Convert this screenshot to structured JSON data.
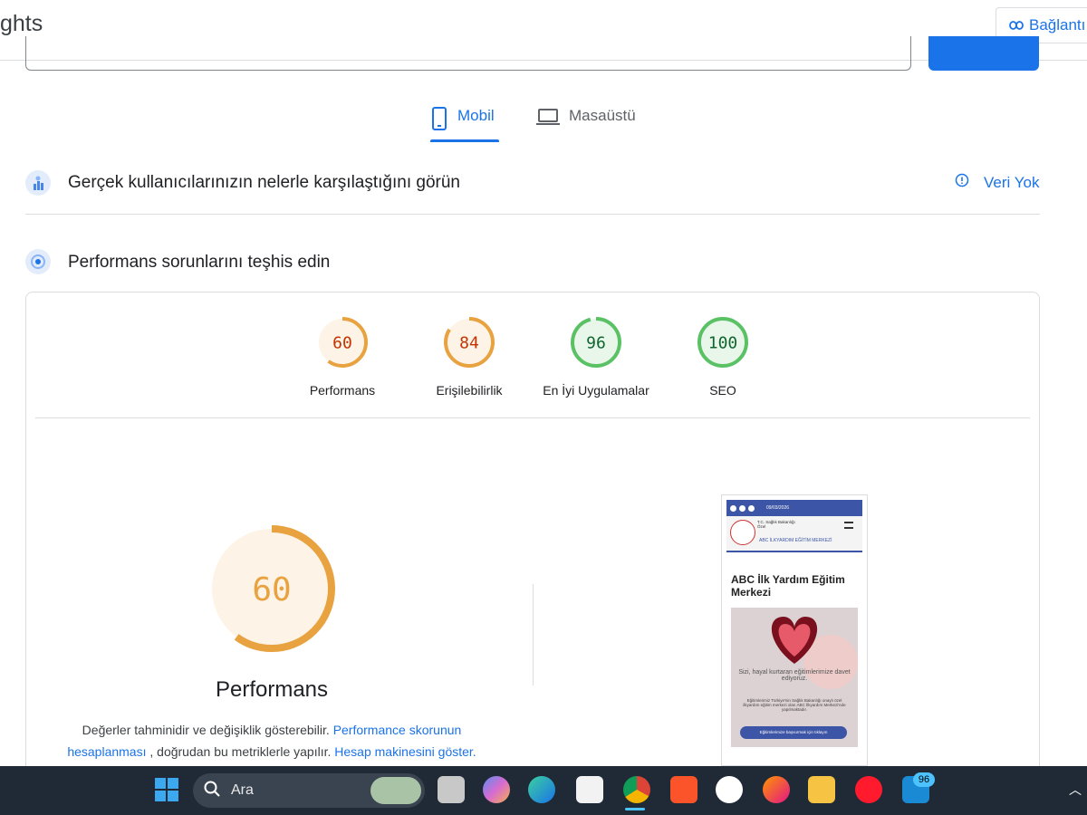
{
  "header": {
    "app_title": "ghts",
    "link_button_label": "Bağlantı"
  },
  "tabs": [
    {
      "label": "Mobil",
      "active": true
    },
    {
      "label": "Masaüstü",
      "active": false
    }
  ],
  "real_users": {
    "title": "Gerçek kullanıcılarınızın nelerle karşılaştığını görün",
    "status": "Veri Yok"
  },
  "diagnose": {
    "title": "Performans sorunlarını teşhis edin"
  },
  "scores": [
    {
      "value": "60",
      "label": "Performans",
      "color": "#e8a23f",
      "fraction": 0.6
    },
    {
      "value": "84",
      "label": "Erişilebilirlik",
      "color": "#e8a23f",
      "fraction": 0.84
    },
    {
      "value": "96",
      "label": "En İyi Uygulamalar",
      "color": "#5ac165",
      "fraction": 0.96
    },
    {
      "value": "100",
      "label": "SEO",
      "color": "#5ac165",
      "fraction": 1.0
    }
  ],
  "performance_detail": {
    "score": "60",
    "title": "Performans",
    "note_text_1": "Değerler tahminidir ve değişiklik gösterebilir.",
    "note_link_1": "Performance skorunun hesaplanması",
    "note_text_2": ", doğrudan bu metriklerle yapılır.",
    "note_link_2": "Hesap makinesini göster."
  },
  "screenshot_thumb": {
    "date": "09/03/2026",
    "org_line": "T.C. Sağlık Bakanlığı Özel",
    "brand": "ABC İLKYARDIM EĞİTİM MERKEZİ",
    "heading": "ABC İlk Yardım Eğitim Merkezi",
    "invite": "Sizi, hayal kurtaran eğitimlerimize davet ediyoruz.",
    "body": "Eğitimlerimiz Türkiye'nin Sağlık Bakanlığı onaylı özel ilkyardım eğitim merkezi olan ABC İlkyardım Merkezi'nde yapılmaktadır.",
    "cta": "Eğitimlerimize başvurmak için tıklayın"
  },
  "taskbar": {
    "search_placeholder": "Ara",
    "badge_count": "96"
  },
  "colors": {
    "accent": "#1a73e8",
    "average": "#e8a23f",
    "good": "#5ac165"
  }
}
